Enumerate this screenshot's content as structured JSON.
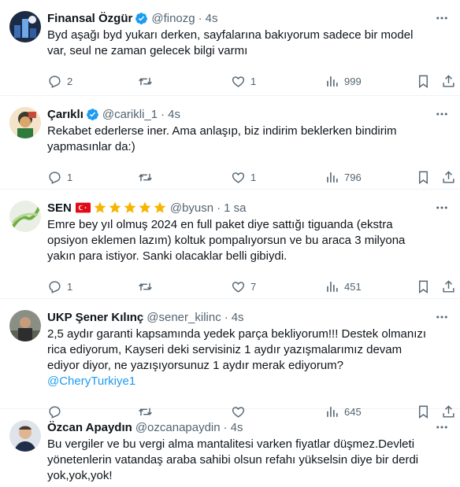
{
  "tweets": [
    {
      "name": "Finansal Özgür",
      "verified": true,
      "handle": "@finozg",
      "time": "4s",
      "text": "Byd aşağı byd yukarı derken, sayfalarına bakıyorum sadece bir model var, seul ne zaman gelecek bilgi varmı",
      "replies": "2",
      "retweets": "",
      "likes": "1",
      "views": "999"
    },
    {
      "name": "Çarıklı",
      "verified": true,
      "handle": "@carikli_1",
      "time": "4s",
      "text": "Rekabet ederlerse iner. Ama anlaşıp, biz indirim beklerken bindirim yapmasınlar da:)",
      "replies": "1",
      "retweets": "",
      "likes": "1",
      "views": "796"
    },
    {
      "name": "SEN",
      "verified": false,
      "handle": "@byusn",
      "time": "1 sa",
      "text": "Emre bey yıl olmuş 2024 en full paket diye sattığı tiguanda (ekstra opsiyon eklemen lazım) koltuk pompalıyorsun ve bu araca 3 milyona yakın para istiyor. Sanki olacaklar belli gibiydi.",
      "replies": "1",
      "retweets": "",
      "likes": "7",
      "views": "451"
    },
    {
      "name": "UKP Şener Kılınç",
      "verified": false,
      "handle": "@sener_kilinc",
      "time": "4s",
      "text": "2,5 aydır garanti kapsamında yedek parça bekliyorum!!! Destek olmanızı rica ediyorum, Kayseri deki servisiniz 1 aydır yazışmalarımız devam ediyor diyor, ne yazışıyorsunuz 1 aydır merak ediyorum? ",
      "mention": "@CheryTurkiye1",
      "replies": "",
      "retweets": "",
      "likes": "",
      "views": "645"
    },
    {
      "name": "Özcan Apaydın",
      "verified": false,
      "handle": "@ozcanapaydin",
      "time": "4s",
      "text": "Bu vergiler ve bu vergi alma mantalitesi varken fiyatlar düşmez.Devleti yönetenlerin vatandaş araba sahibi olsun refahı yükselsin diye bir derdi yok,yok,yok!"
    }
  ],
  "colors": {
    "accent": "#1d9bf0",
    "muted": "#536471",
    "star": "#f7b500"
  },
  "icons": [
    "verified-badge-icon",
    "turkey-flag-icon",
    "star-icon",
    "more-icon",
    "reply-icon",
    "retweet-icon",
    "like-icon",
    "views-icon",
    "bookmark-icon",
    "share-icon"
  ]
}
